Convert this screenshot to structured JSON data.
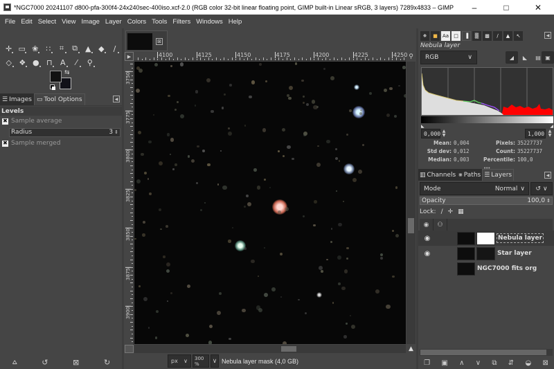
{
  "window": {
    "title": "*NGC7000 20241107 d800-pfa-300f4-24x240sec-400iso.xcf-2.0 (RGB color 32-bit linear floating point, GIMP built-in Linear sRGB, 3 layers) 7289x4833 – GIMP",
    "minimize": "–",
    "maximize": "□",
    "close": "✕"
  },
  "menubar": [
    "File",
    "Edit",
    "Select",
    "View",
    "Image",
    "Layer",
    "Colors",
    "Tools",
    "Filters",
    "Windows",
    "Help"
  ],
  "toolbox": {
    "row1": [
      {
        "name": "move-tool-icon",
        "glyph": "✛"
      },
      {
        "name": "rect-select-tool-icon",
        "glyph": "▭"
      },
      {
        "name": "free-select-tool-icon",
        "glyph": "❀"
      },
      {
        "name": "fuzzy-select-tool-icon",
        "glyph": "∷"
      },
      {
        "name": "crop-tool-icon",
        "glyph": "⌗"
      },
      {
        "name": "unified-transform-tool-icon",
        "glyph": "⧉"
      },
      {
        "name": "warp-transform-tool-icon",
        "glyph": "▲"
      },
      {
        "name": "bucket-fill-tool-icon",
        "glyph": "◆"
      },
      {
        "name": "paintbrush-tool-icon",
        "glyph": "∕"
      }
    ],
    "row2": [
      {
        "name": "eraser-tool-icon",
        "glyph": "◇"
      },
      {
        "name": "heal-tool-icon",
        "glyph": "❖"
      },
      {
        "name": "smudge-tool-icon",
        "glyph": "●"
      },
      {
        "name": "paths-tool-icon",
        "glyph": "⊓"
      },
      {
        "name": "text-tool-icon",
        "glyph": "A"
      },
      {
        "name": "color-picker-tool-icon",
        "glyph": "⁄"
      },
      {
        "name": "zoom-tool-icon",
        "glyph": "⚲"
      }
    ],
    "fg_color": "#121212",
    "bg_color": "#121219",
    "swap_glyph": "⇆"
  },
  "left_tabs": [
    {
      "label": "Images",
      "icon": "☰"
    },
    {
      "label": "Tool Options",
      "icon": "▭"
    }
  ],
  "tool_options": {
    "heading": "Levels",
    "sample_average": {
      "label": "Sample average",
      "checked": true
    },
    "radius": {
      "label": "Radius",
      "value": "3"
    },
    "sample_merged": {
      "label": "Sample merged",
      "checked": true
    },
    "check_glyph": "✖"
  },
  "left_bottom_buttons": [
    {
      "name": "save-tool-preset-button",
      "glyph": "⩟"
    },
    {
      "name": "restore-tool-preset-button",
      "glyph": "↺"
    },
    {
      "name": "delete-tool-preset-button",
      "glyph": "⊠"
    },
    {
      "name": "reset-tool-options-button",
      "glyph": "↻"
    }
  ],
  "image_tab": {
    "close_glyph": "⊠"
  },
  "rulers": {
    "horizontal": [
      "4100",
      "4125",
      "4150",
      "4175",
      "4200",
      "4225",
      "4250"
    ],
    "vertical": [
      "3750",
      "3775",
      "3800",
      "3825",
      "3850",
      "3875",
      "3900"
    ]
  },
  "statusbar": {
    "unit": "px",
    "zoom": "300 %",
    "message": "Nebula layer mask (4,0 GB)",
    "chevron": "∨"
  },
  "histogram": {
    "tabs": [
      {
        "name": "tab-tool-options-icon",
        "glyph": "✵"
      },
      {
        "name": "tab-colors-icon",
        "glyph": "■"
      },
      {
        "name": "tab-fonts-icon",
        "glyph": "Aa"
      },
      {
        "name": "tab-document-icon",
        "glyph": "□"
      },
      {
        "name": "tab-histogram-icon",
        "glyph": "▐"
      },
      {
        "name": "tab-patterns-icon",
        "glyph": "▒"
      },
      {
        "name": "tab-gradients-icon",
        "glyph": "▩"
      },
      {
        "name": "tab-brushes-icon",
        "glyph": "∕"
      },
      {
        "name": "tab-dynamics-icon",
        "glyph": "▲"
      },
      {
        "name": "tab-pointer-icon",
        "glyph": "↖"
      }
    ],
    "layer_name": "Nebula layer",
    "channel": "RGB",
    "range_min": "0,000",
    "range_max": "1,000",
    "stats": {
      "mean_label": "Mean:",
      "mean": "0,004",
      "stddev_label": "Std dev:",
      "stddev": "0,012",
      "median_label": "Median:",
      "median": "0,003",
      "pixels_label": "Pixels:",
      "pixels": "35227737",
      "count_label": "Count:",
      "count": "35227737",
      "percentile_label": "Percentile:",
      "percentile": "100,0"
    }
  },
  "layers_panel": {
    "tabs": [
      {
        "label": "Channels",
        "icon": "▥"
      },
      {
        "label": "Paths",
        "icon": "⨳"
      },
      {
        "label": "Layers",
        "icon": "☰"
      }
    ],
    "mode_label": "Mode",
    "mode_value": "Normal",
    "opacity_label": "Opacity",
    "opacity_value": "100,0",
    "lock_label": "Lock:",
    "layers": [
      {
        "name": "Nebula layer",
        "visible": true,
        "has_mask": true,
        "mask_color": "#ffffff",
        "selected": true
      },
      {
        "name": "Star layer",
        "visible": true,
        "has_mask": true,
        "mask_color": "#151515",
        "selected": false
      },
      {
        "name": "NGC7000 fits org",
        "visible": false,
        "has_mask": false,
        "selected": false
      }
    ],
    "bottom_buttons": [
      {
        "name": "new-layer-button",
        "glyph": "❐"
      },
      {
        "name": "new-layer-group-button",
        "glyph": "▣"
      },
      {
        "name": "raise-layer-button",
        "glyph": "∧"
      },
      {
        "name": "lower-layer-button",
        "glyph": "∨"
      },
      {
        "name": "duplicate-layer-button",
        "glyph": "⧉"
      },
      {
        "name": "merge-layer-button",
        "glyph": "⇵"
      },
      {
        "name": "add-mask-button",
        "glyph": "◒"
      },
      {
        "name": "delete-layer-button",
        "glyph": "⊠"
      }
    ]
  }
}
